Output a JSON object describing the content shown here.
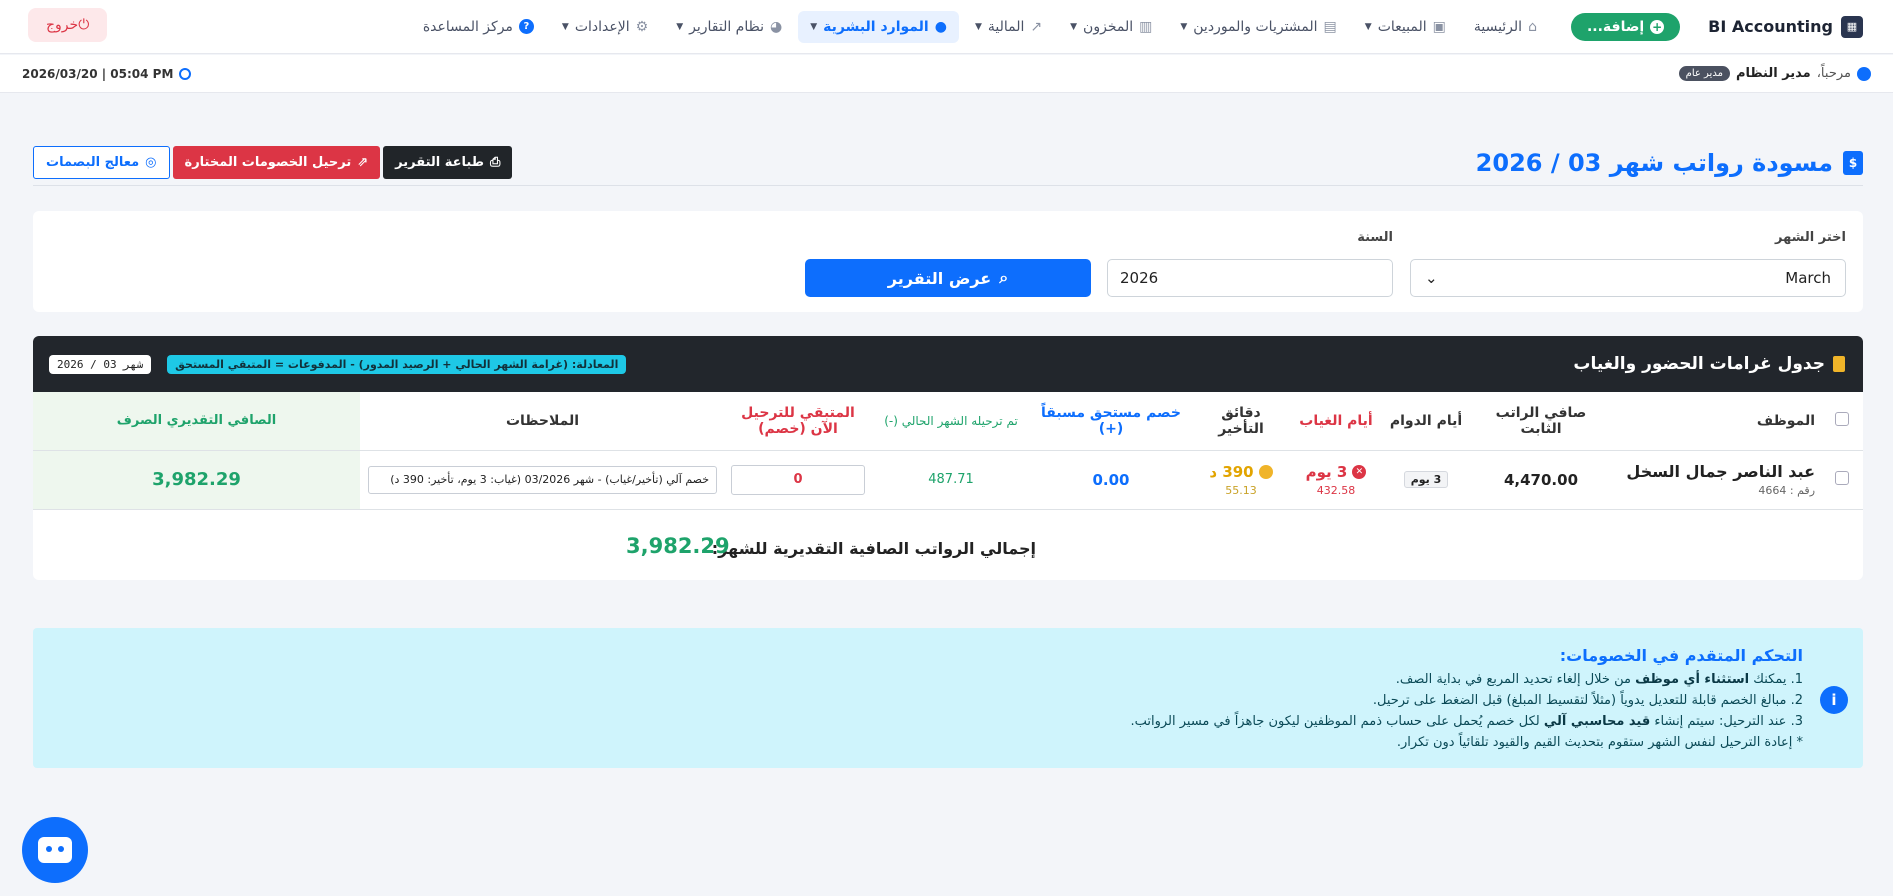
{
  "nav": {
    "brand": "BI Accounting",
    "add_label": "إضافة...",
    "items": [
      {
        "label": "الرئيسية",
        "icon": "home-icon",
        "has_caret": false
      },
      {
        "label": "المبيعات",
        "icon": "bag-icon",
        "has_caret": true
      },
      {
        "label": "المشتريات والموردين",
        "icon": "truck-icon",
        "has_caret": true
      },
      {
        "label": "المخزون",
        "icon": "boxes-icon",
        "has_caret": true
      },
      {
        "label": "المالية",
        "icon": "chart-line-icon",
        "has_caret": true
      },
      {
        "label": "الموارد البشرية",
        "icon": "users-icon",
        "has_caret": true,
        "active": true
      },
      {
        "label": "نظام التقارير",
        "icon": "pie-chart-icon",
        "has_caret": true
      },
      {
        "label": "الإعدادات",
        "icon": "gear-icon",
        "has_caret": true
      },
      {
        "label": "مركز المساعدة",
        "icon": "help-icon",
        "has_caret": false
      }
    ],
    "logout": "خروج"
  },
  "subbar": {
    "welcome_prefix": "مرحباً،",
    "user_name": "مدير النظام",
    "role": "مدير عام",
    "datetime": "2026/03/20 | 05:04 PM"
  },
  "page": {
    "title": "مسودة رواتب شهر 03 / 2026",
    "print_label": "طباعة التقرير",
    "post_label": "ترحيل الخصومات المختارة",
    "fingerprint_label": "معالج البصمات"
  },
  "filters": {
    "month_label": "اختر الشهر",
    "month_value": "March",
    "year_label": "السنة",
    "year_value": "2026",
    "submit_label": "عرض التقرير"
  },
  "table": {
    "title": "جدول غرامات الحضور والغياب",
    "formula": "المعادلة: (غرامة الشهر الحالي + الرصيد المدور) - المدفوعات = المتبقي المستحق",
    "month_badge": "شهر 03 / 2026",
    "headers": {
      "employee": "الموظف",
      "salary": "صافي الراتب الثابت",
      "work_days": "أيام الدوام",
      "absent_days": "أيام الغياب",
      "late_minutes": "دقائق التأخير",
      "prepaid": "خصم مستحق مسبقاً (+)",
      "posted": "تم ترحيله الشهر الحالي (-)",
      "remaining": "المتبقي للترحيل الآن (خصم)",
      "notes": "الملاحظات",
      "net": "الصافي التقديري الصرف"
    },
    "rows": [
      {
        "name": "عبد الناصر جمال السخل",
        "id_label": "رقم :",
        "id": "4664",
        "salary": "4,470.00",
        "work_days": "3 يوم",
        "absent_days": "3 يوم",
        "absent_amount": "432.58",
        "late_minutes": "390 د",
        "late_amount": "55.13",
        "prepaid": "0.00",
        "posted": "487.71",
        "remaining": "0",
        "note": "خصم آلي (تأخير/غياب) - شهر 03/2026 (غياب: 3 يوم، تأخير: 390 د)",
        "net": "3,982.29"
      }
    ],
    "total_label": "إجمالي الرواتب الصافية التقديرية للشهر:",
    "total_value": "3,982.29"
  },
  "info": {
    "title": "التحكم المتقدم في الخصومات:",
    "line1_a": "1. يمكنك ",
    "line1_b": "استثناء أي موظف",
    "line1_c": " من خلال إلغاء تحديد المربع في بداية الصف.",
    "line2": "2. مبالغ الخصم قابلة للتعديل يدوياً (مثلاً لتقسيط المبلغ) قبل الضغط على ترحيل.",
    "line3_a": "3. عند الترحيل: سيتم إنشاء ",
    "line3_b": "قيد محاسبي آلي",
    "line3_c": " لكل خصم يُحمل على حساب ذمم الموظفين ليكون جاهزاً في مسير الرواتب.",
    "line4": "* إعادة الترحيل لنفس الشهر ستقوم بتحديث القيم والقيود تلقائياً دون تكرار."
  },
  "colors": {
    "primary": "#0d6efd",
    "success": "#1ea36b",
    "danger": "#dc3545",
    "warning": "#f0b429",
    "info_bg": "#cff4fc"
  }
}
